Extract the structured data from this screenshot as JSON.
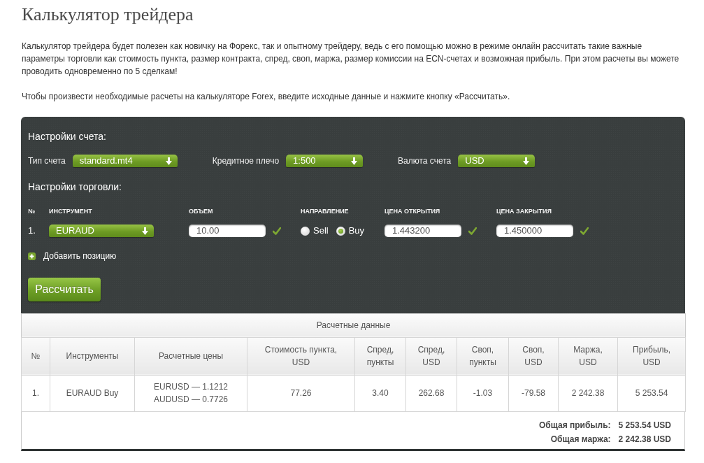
{
  "page": {
    "title": "Калькулятор трейдера",
    "paragraphs": [
      "Калькулятор трейдера будет полезен как новичку на Форекс, так и опытному трейдеру, ведь с его помощью можно в режиме онлайн рассчитать такие важные параметры торговли как стоимость пункта, размер контракта, спред, своп, маржа, размер комиссии на ECN-счетах и возможная прибыль. При этом расчеты вы можете проводить одновременно по 5 сделкам!",
      "Чтобы произвести необходимые расчеты на калькуляторе Forex, введите исходные данные и нажмите кнопку «Рассчитать»."
    ]
  },
  "account_settings": {
    "heading": "Настройки счета:",
    "fields": [
      {
        "label": "Тип счета",
        "value": "standard.mt4"
      },
      {
        "label": "Кредитное плечо",
        "value": "1:500"
      },
      {
        "label": "Валюта счета",
        "value": "USD"
      }
    ]
  },
  "trade_settings": {
    "heading": "Настройки торговли:",
    "columns": [
      "№",
      "ИНСТРУМЕНТ",
      "ОБЪЕМ",
      "НАПРАВЛЕНИЕ",
      "ЦЕНА ОТКРЫТИЯ",
      "ЦЕНА ЗАКРЫТИЯ"
    ],
    "positions": [
      {
        "number": "1.",
        "instrument": "EURAUD",
        "volume": {
          "value": "10.00",
          "valid": true
        },
        "directions": [
          {
            "label": "Sell",
            "selected": false
          },
          {
            "label": "Buy",
            "selected": true
          }
        ],
        "open_price": {
          "value": "1.443200",
          "valid": true
        },
        "close_price": {
          "value": "1.450000",
          "valid": true
        }
      }
    ],
    "add_position": "Добавить позицию",
    "calculate_button": "Рассчитать"
  },
  "results": {
    "title": "Расчетные данные",
    "columns": [
      "№",
      "Инструменты",
      "Расчетные цены",
      "Стоимость пункта, USD",
      "Спред, пункты",
      "Спред, USD",
      "Своп, пункты",
      "Своп, USD",
      "Маржа, USD",
      "Прибыль, USD"
    ],
    "rows": [
      [
        "1.",
        "EURAUD Buy",
        [
          "EURUSD — 1.1212",
          "AUDUSD — 0.7726"
        ],
        "77.26",
        "3.40",
        "262.68",
        "-1.03",
        "-79.58",
        "2 242.38",
        "5 253.54"
      ]
    ],
    "totals": [
      {
        "label": "Общая прибыль:",
        "value": "5 253.54 USD"
      },
      {
        "label": "Общая маржа:",
        "value": "2 242.38 USD"
      }
    ]
  }
}
